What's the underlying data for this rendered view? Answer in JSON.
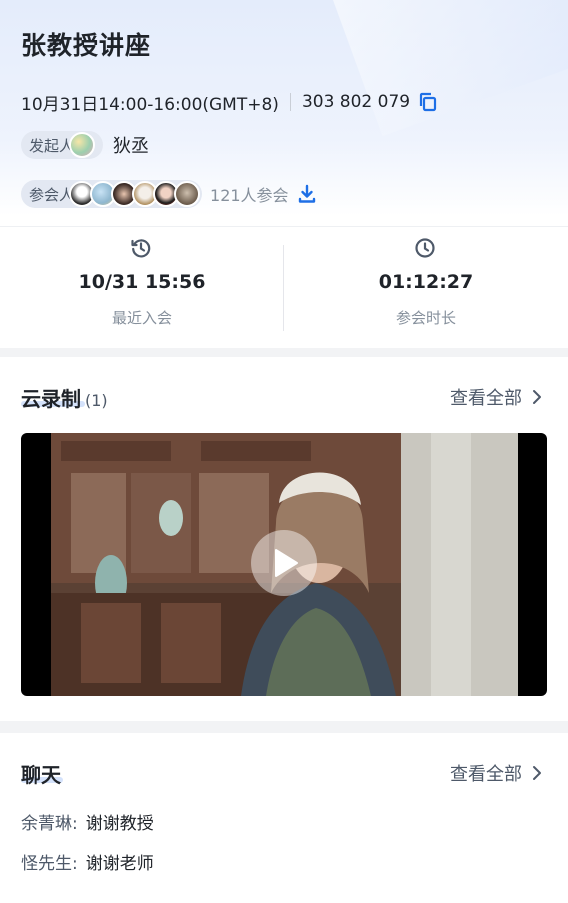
{
  "meeting": {
    "title": "张教授讲座",
    "time": "10月31日14:00-16:00(GMT+8)",
    "meeting_id": "303 802 079"
  },
  "host": {
    "label": "发起人",
    "name": "狄丞"
  },
  "attendees": {
    "label": "参会人",
    "count_text": "121人参会"
  },
  "stats": [
    {
      "value": "10/31 15:56",
      "label": "最近入会",
      "icon": "history-clock-icon"
    },
    {
      "value": "01:12:27",
      "label": "参会时长",
      "icon": "clock-icon"
    }
  ],
  "recording": {
    "title": "云录制",
    "count": "(1)",
    "view_all": "查看全部"
  },
  "chat": {
    "title": "聊天",
    "view_all": "查看全部",
    "messages": [
      {
        "sender": "余菁琳:",
        "text": "谢谢教授"
      },
      {
        "sender": "怪先生:",
        "text": "谢谢老师"
      }
    ]
  },
  "colors": {
    "accent": "#1e6fe6",
    "annotation_red": "#e8363c"
  }
}
